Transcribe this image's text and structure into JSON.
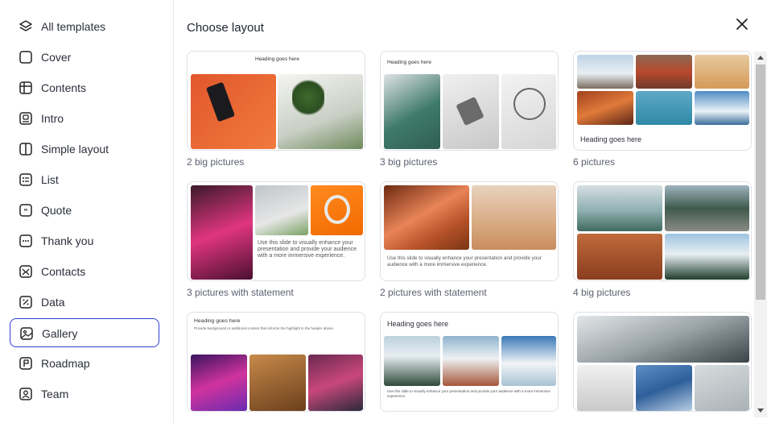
{
  "sidebar": {
    "items": [
      {
        "label": "All templates",
        "icon": "layers-icon"
      },
      {
        "label": "Cover",
        "icon": "square-icon"
      },
      {
        "label": "Contents",
        "icon": "table-icon"
      },
      {
        "label": "Intro",
        "icon": "intro-icon"
      },
      {
        "label": "Simple layout",
        "icon": "split-icon"
      },
      {
        "label": "List",
        "icon": "list-icon"
      },
      {
        "label": "Quote",
        "icon": "quote-icon"
      },
      {
        "label": "Thank you",
        "icon": "dots-icon"
      },
      {
        "label": "Contacts",
        "icon": "contacts-icon"
      },
      {
        "label": "Data",
        "icon": "percent-icon"
      },
      {
        "label": "Gallery",
        "icon": "image-icon",
        "active": true
      },
      {
        "label": "Roadmap",
        "icon": "flag-icon"
      },
      {
        "label": "Team",
        "icon": "user-icon"
      }
    ]
  },
  "main": {
    "title": "Choose layout",
    "close_icon": "close-icon",
    "layouts": [
      {
        "caption": "2 big pictures",
        "heading": "Heading goes here"
      },
      {
        "caption": "3 big pictures",
        "heading": "Heading goes here"
      },
      {
        "caption": "6 pictures",
        "heading": "Heading goes here"
      },
      {
        "caption": "3 pictures with statement",
        "statement": "Use this slide to visually enhance your presentation and provide your audience with a more immersive experience."
      },
      {
        "caption": "2 pictures with statement",
        "statement": "Use this slide to visually enhance your presentation and provide your audience with a more immersive experience."
      },
      {
        "caption": "4 big pictures"
      },
      {
        "caption": "",
        "heading": "Heading goes here",
        "subtext": "Provide background or additional context that informs the highlight in the header above."
      },
      {
        "caption": "",
        "heading": "Heading goes here",
        "statement": "Use this slide to visually enhance your presentation and provide your audience with a more immersive experience."
      },
      {
        "caption": ""
      }
    ]
  },
  "colors": {
    "active_border": "#2f3fd6",
    "text": "#2b2f3a",
    "caption": "#5c6170",
    "card_border": "#dfe1e6"
  }
}
